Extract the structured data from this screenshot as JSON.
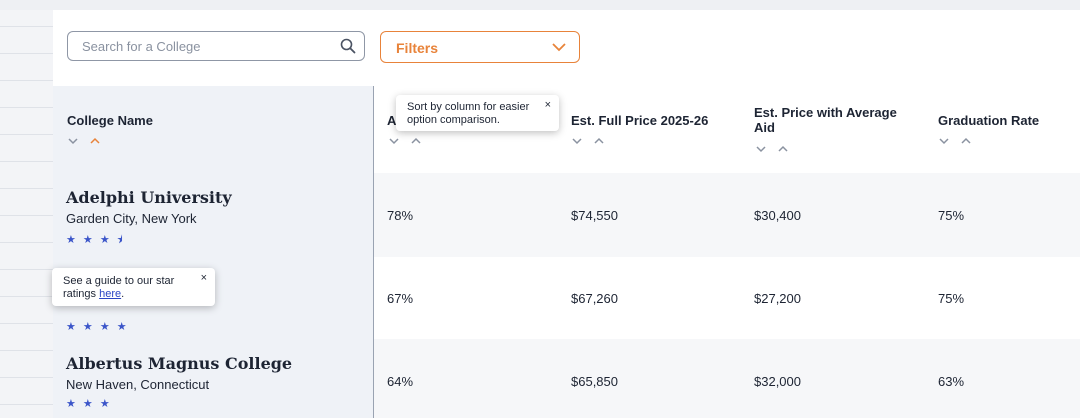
{
  "search": {
    "placeholder": "Search for a College"
  },
  "filters": {
    "label": "Filters"
  },
  "table": {
    "headers": {
      "college_name": "College Name",
      "acceptance": "A",
      "full_price": "Est. Full Price 2025-26",
      "avg_aid_line1": "Est. Price with Average",
      "avg_aid_line2": "Aid",
      "graduation": "Graduation Rate"
    },
    "rows": [
      {
        "name": "Adelphi University",
        "location": "Garden City, New York",
        "stars": "★ ★ ★ ⯨",
        "acceptance": "78%",
        "full_price": "$74,550",
        "avg_aid": "$30,400",
        "graduation": "75%"
      },
      {
        "name": "",
        "location": "",
        "stars": "★ ★ ★ ★",
        "acceptance": "67%",
        "full_price": "$67,260",
        "avg_aid": "$27,200",
        "graduation": "75%"
      },
      {
        "name": "Albertus Magnus College",
        "location": "New Haven, Connecticut",
        "stars": "★ ★ ★",
        "acceptance": "64%",
        "full_price": "$65,850",
        "avg_aid": "$32,000",
        "graduation": "63%"
      }
    ]
  },
  "tooltips": {
    "sort": {
      "line1": "Sort by column for easier",
      "line2": "option comparison.",
      "close": "×"
    },
    "stars": {
      "line1": "See a guide to our star",
      "line2_prefix": "ratings ",
      "link": "here",
      "line2_suffix": ".",
      "close": "×"
    }
  },
  "colors": {
    "accent": "#e8833a",
    "star": "#3b55c9",
    "link": "#2a45c4"
  }
}
